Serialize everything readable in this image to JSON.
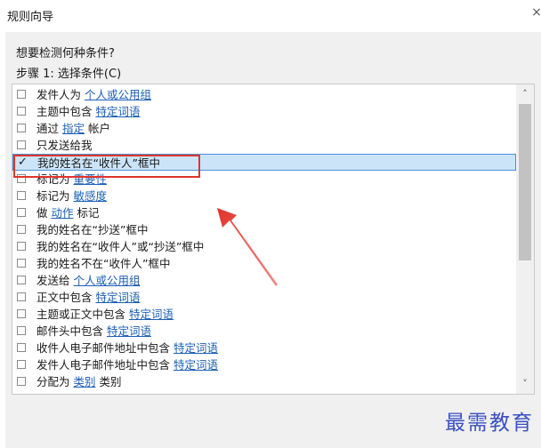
{
  "window": {
    "title": "规则向导",
    "close_glyph": "×"
  },
  "wizard": {
    "question": "想要检测何种条件?",
    "step_label": "步骤 1: 选择条件(C)"
  },
  "conditions": [
    {
      "prefix": "发件人为 ",
      "link": "个人或公用组",
      "suffix": "",
      "checked": false
    },
    {
      "prefix": "主题中包含 ",
      "link": "特定词语",
      "suffix": "",
      "checked": false
    },
    {
      "prefix": "通过 ",
      "link": "指定",
      "suffix": " 帐户",
      "checked": false
    },
    {
      "prefix": "只发送给我",
      "link": "",
      "suffix": "",
      "checked": false
    },
    {
      "prefix": "我的姓名在“收件人”框中",
      "link": "",
      "suffix": "",
      "checked": true
    },
    {
      "prefix": "标记为 ",
      "link": "重要性",
      "suffix": "",
      "checked": false
    },
    {
      "prefix": "标记为 ",
      "link": "敏感度",
      "suffix": "",
      "checked": false
    },
    {
      "prefix": "做 ",
      "link": "动作",
      "suffix": " 标记",
      "checked": false
    },
    {
      "prefix": "我的姓名在“抄送”框中",
      "link": "",
      "suffix": "",
      "checked": false
    },
    {
      "prefix": "我的姓名在“收件人”或“抄送”框中",
      "link": "",
      "suffix": "",
      "checked": false
    },
    {
      "prefix": "我的姓名不在“收件人”框中",
      "link": "",
      "suffix": "",
      "checked": false
    },
    {
      "prefix": "发送给 ",
      "link": "个人或公用组",
      "suffix": "",
      "checked": false
    },
    {
      "prefix": "正文中包含 ",
      "link": "特定词语",
      "suffix": "",
      "checked": false
    },
    {
      "prefix": "主题或正文中包含 ",
      "link": "特定词语",
      "suffix": "",
      "checked": false
    },
    {
      "prefix": "邮件头中包含 ",
      "link": "特定词语",
      "suffix": "",
      "checked": false
    },
    {
      "prefix": "收件人电子邮件地址中包含 ",
      "link": "特定词语",
      "suffix": "",
      "checked": false
    },
    {
      "prefix": "发件人电子邮件地址中包含 ",
      "link": "特定词语",
      "suffix": "",
      "checked": false
    },
    {
      "prefix": "分配为 ",
      "link": "类别",
      "suffix": " 类别",
      "checked": false
    }
  ],
  "selected_index": 4,
  "scrollbar": {
    "up_icon": "chevron-up-icon",
    "down_icon": "chevron-down-icon",
    "up_glyph": "˄",
    "down_glyph": "˅"
  },
  "annotation": {
    "box_color": "#e0342c",
    "arrow_color": "#e0342c"
  },
  "watermark": "最需教育",
  "colors": {
    "link": "#1c5fb4",
    "selection": "#cce4f7",
    "watermark": "#3b4fc0"
  }
}
